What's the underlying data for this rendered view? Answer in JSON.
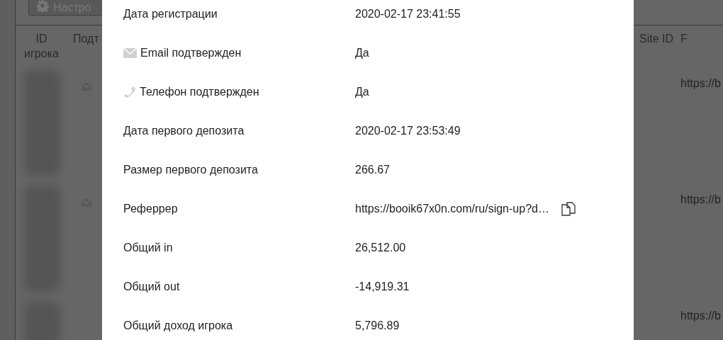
{
  "background": {
    "settings_button": "Настро",
    "columns": [
      "ID игрока",
      "Подт",
      "Site ID",
      "F"
    ],
    "rows": [
      {
        "email_icon": true,
        "link": "https://b"
      },
      {
        "email_icon": true,
        "link": "https://b"
      },
      {
        "email_icon": false,
        "link": "https://b"
      }
    ]
  },
  "details": [
    {
      "label": "Дата регистрации",
      "value": "2020-02-17 23:41:55"
    },
    {
      "label": "Email подтвержден",
      "kind": "email",
      "value": "Да"
    },
    {
      "label": "Телефон подтвержден",
      "kind": "phone",
      "value": "Да"
    },
    {
      "label": "Дата первого депозита",
      "value": "2020-02-17 23:53:49"
    },
    {
      "label": "Размер первого депозита",
      "value": "266.67"
    },
    {
      "label": "Реферрер",
      "value": "https://booik67x0n.com/ru/sign-up?d…",
      "copyable": true
    },
    {
      "label": "Общий in",
      "value": "26,512.00"
    },
    {
      "label": "Общий out",
      "value": "-14,919.31"
    },
    {
      "label": "Общий доход игрока",
      "value": "5,796.89"
    }
  ]
}
